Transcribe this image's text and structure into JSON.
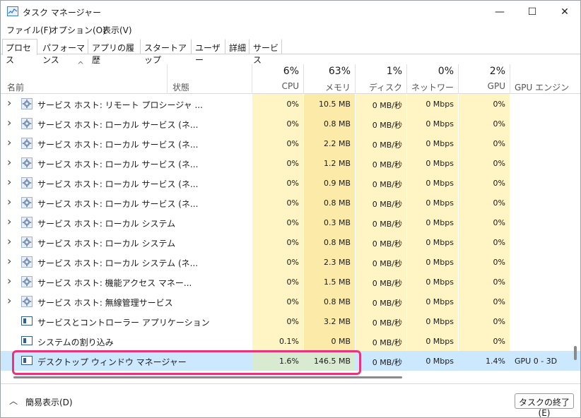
{
  "window": {
    "title": "タスク マネージャー"
  },
  "titlebar": {
    "minimize": "—",
    "maximize": "☐",
    "close": "✕"
  },
  "menu": [
    "ファイル(F)",
    "オプション(O)",
    "表示(V)"
  ],
  "tabs": [
    "プロセス",
    "パフォーマンス",
    "アプリの履歴",
    "スタートアップ",
    "ユーザー",
    "詳細",
    "サービス"
  ],
  "columns": {
    "name": "名前",
    "status": "状態",
    "cpu": {
      "pct": "6%",
      "label": "CPU"
    },
    "memory": {
      "pct": "63%",
      "label": "メモリ"
    },
    "disk": {
      "pct": "1%",
      "label": "ディスク"
    },
    "network": {
      "pct": "0%",
      "label": "ネットワーク"
    },
    "gpu": {
      "pct": "2%",
      "label": "GPU"
    },
    "gpu_engine": "GPU エンジン"
  },
  "rows": [
    {
      "name": "サービス ホスト: リモート プロシージャ ...",
      "cpu": "0%",
      "memory": "10.5 MB",
      "disk": "0 MB/秒",
      "network": "0 Mbps",
      "gpu": "0%",
      "gpu_engine": ""
    },
    {
      "name": "サービス ホスト: ローカル サービス (ネ...",
      "cpu": "0%",
      "memory": "0.8 MB",
      "disk": "0 MB/秒",
      "network": "0 Mbps",
      "gpu": "0%",
      "gpu_engine": ""
    },
    {
      "name": "サービス ホスト: ローカル サービス (ネ...",
      "cpu": "0%",
      "memory": "2.2 MB",
      "disk": "0 MB/秒",
      "network": "0 Mbps",
      "gpu": "0%",
      "gpu_engine": ""
    },
    {
      "name": "サービス ホスト: ローカル サービス (ネ...",
      "cpu": "0%",
      "memory": "1.2 MB",
      "disk": "0 MB/秒",
      "network": "0 Mbps",
      "gpu": "0%",
      "gpu_engine": ""
    },
    {
      "name": "サービス ホスト: ローカル サービス (ネ...",
      "cpu": "0%",
      "memory": "0.9 MB",
      "disk": "0 MB/秒",
      "network": "0 Mbps",
      "gpu": "0%",
      "gpu_engine": ""
    },
    {
      "name": "サービス ホスト: ローカル サービス (ネ...",
      "cpu": "0%",
      "memory": "0.8 MB",
      "disk": "0 MB/秒",
      "network": "0 Mbps",
      "gpu": "0%",
      "gpu_engine": ""
    },
    {
      "name": "サービス ホスト: ローカル システム",
      "cpu": "0%",
      "memory": "0.3 MB",
      "disk": "0 MB/秒",
      "network": "0 Mbps",
      "gpu": "0%",
      "gpu_engine": ""
    },
    {
      "name": "サービス ホスト: ローカル システム",
      "cpu": "0%",
      "memory": "0.8 MB",
      "disk": "0 MB/秒",
      "network": "0 Mbps",
      "gpu": "0%",
      "gpu_engine": ""
    },
    {
      "name": "サービス ホスト: ローカル システム (ネ...",
      "cpu": "0%",
      "memory": "2.3 MB",
      "disk": "0 MB/秒",
      "network": "0 Mbps",
      "gpu": "0%",
      "gpu_engine": ""
    },
    {
      "name": "サービス ホスト: 機能アクセス マネー...",
      "cpu": "0%",
      "memory": "1.5 MB",
      "disk": "0 MB/秒",
      "network": "0 Mbps",
      "gpu": "0%",
      "gpu_engine": ""
    },
    {
      "name": "サービス ホスト: 無線管理サービス",
      "cpu": "0%",
      "memory": "0.8 MB",
      "disk": "0 MB/秒",
      "network": "0 Mbps",
      "gpu": "0%",
      "gpu_engine": ""
    },
    {
      "name": "サービスとコントローラー アプリケーション",
      "cpu": "0%",
      "memory": "3.2 MB",
      "disk": "0 MB/秒",
      "network": "0 Mbps",
      "gpu": "0%",
      "gpu_engine": ""
    },
    {
      "name": "システムの割り込み",
      "cpu": "0.1%",
      "memory": "0 MB",
      "disk": "0 MB/秒",
      "network": "0 Mbps",
      "gpu": "0%",
      "gpu_engine": ""
    },
    {
      "name": "デスクトップ ウィンドウ マネージャー",
      "cpu": "1.6%",
      "memory": "146.5 MB",
      "disk": "0 MB/秒",
      "network": "0 Mbps",
      "gpu": "1.4%",
      "gpu_engine": "GPU 0 - 3D"
    }
  ],
  "row_icons": [
    "gear-icon",
    "gear-icon",
    "gear-icon",
    "gear-icon",
    "gear-icon",
    "gear-icon",
    "gear-icon",
    "gear-icon",
    "gear-icon",
    "gear-icon",
    "gear-icon",
    "process-window-icon",
    "process-window-icon",
    "process-window-icon"
  ],
  "row_expandable": [
    true,
    true,
    true,
    true,
    true,
    true,
    true,
    true,
    true,
    true,
    true,
    false,
    false,
    false
  ],
  "selected_row": 13,
  "colors": {
    "cpu_heat": "#fff4c4",
    "memory_heat": "#fbeaa8",
    "other_heat": "#fff4c4",
    "selected_row": "#cce8ff",
    "highlight_border": "#e8347a"
  },
  "footer": {
    "fewer_details": "簡易表示(D)",
    "end_task": "タスクの終了(E)"
  }
}
